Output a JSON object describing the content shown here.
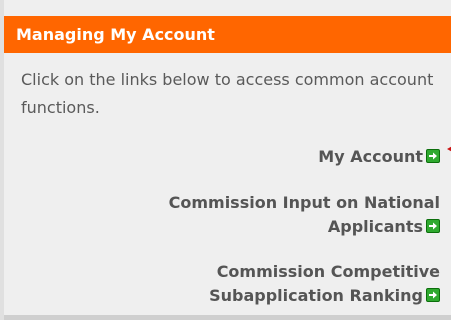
{
  "panel": {
    "title": "Managing My Account",
    "intro": "Click on the links below to access common account functions.",
    "links": [
      {
        "label": "My Account"
      },
      {
        "line1": "Commission Input on National",
        "line2": "Applicants"
      },
      {
        "line1": "Commission Competitive",
        "line2": "Subapplication Ranking"
      }
    ]
  },
  "colors": {
    "header": "#ff6600",
    "panel_bg": "#efefef",
    "link_text": "#555555",
    "arrow_icon": "#2fa92f"
  }
}
